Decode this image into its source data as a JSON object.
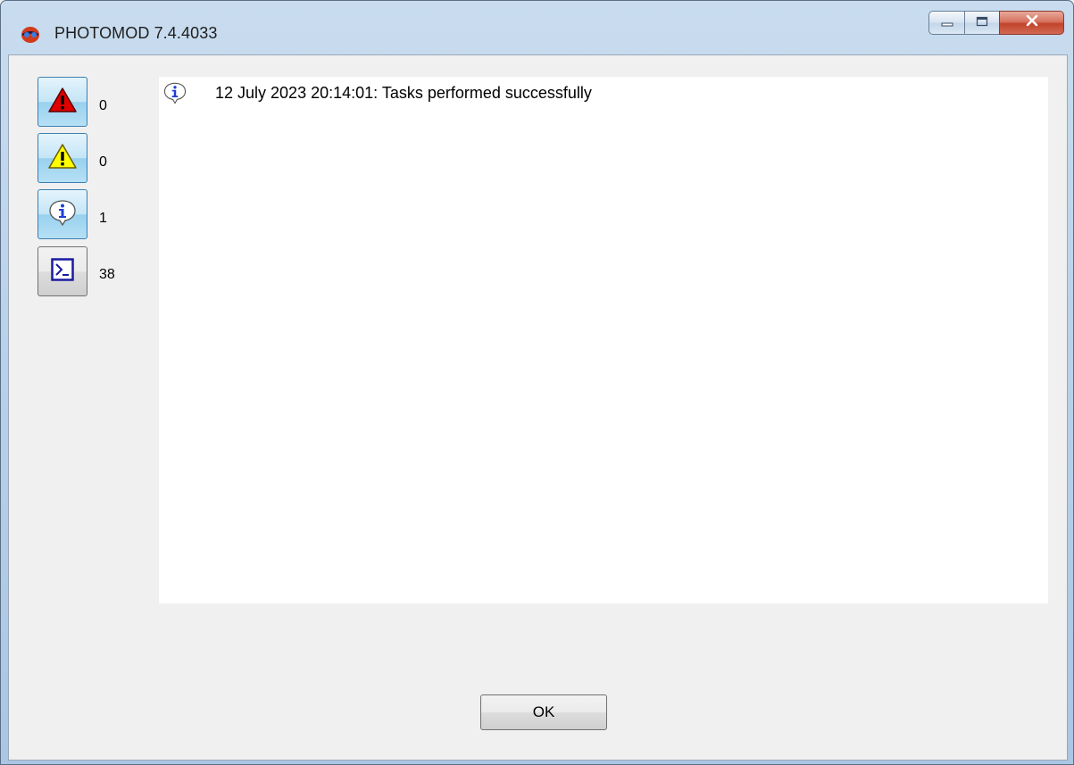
{
  "window": {
    "title": "PHOTOMOD 7.4.4033",
    "app_icon": "photomod-app-icon",
    "controls": {
      "minimize": "minimize-icon",
      "maximize": "maximize-icon",
      "close": "close-icon"
    }
  },
  "filters": [
    {
      "icon": "error-icon",
      "count": "0",
      "active": true
    },
    {
      "icon": "warning-icon",
      "count": "0",
      "active": true
    },
    {
      "icon": "info-icon",
      "count": "1",
      "active": true
    },
    {
      "icon": "console-icon",
      "count": "38",
      "active": false
    }
  ],
  "log": {
    "entries": [
      {
        "icon": "info-icon",
        "text": "12 July 2023 20:14:01: Tasks performed successfully"
      }
    ]
  },
  "footer": {
    "ok_label": "OK"
  },
  "colors": {
    "error": "#e00000",
    "warning": "#ffff00",
    "info": "#1e3fd6",
    "console": "#1a1aa0",
    "selected_button": "#98d1ef"
  }
}
